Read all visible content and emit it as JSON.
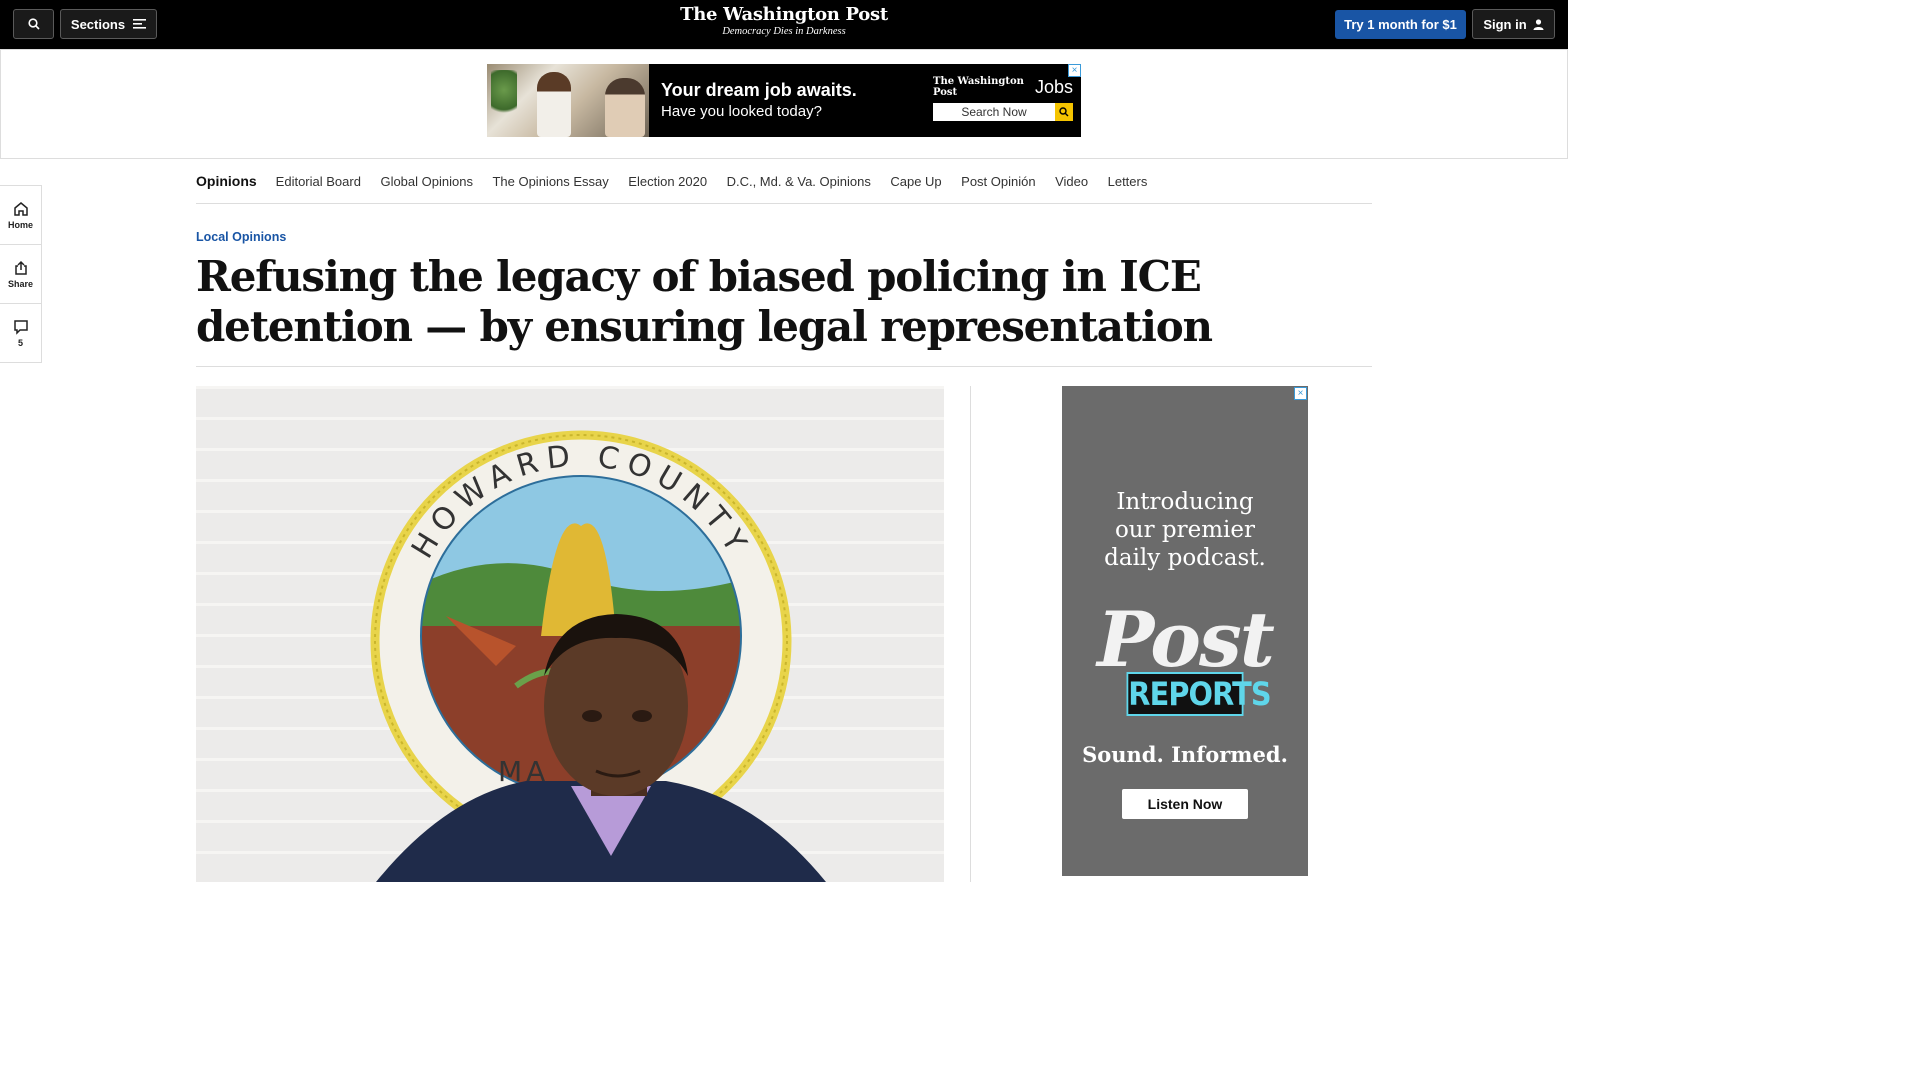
{
  "header": {
    "logo": "The Washington Post",
    "tagline": "Democracy Dies in Darkness",
    "sections_label": "Sections",
    "try_label": "Try 1 month for $1",
    "signin_label": "Sign in"
  },
  "top_ad": {
    "headline": "Your dream job awaits.",
    "subline": "Have you looked today?",
    "brand": "The Washington Post",
    "brand_suffix": "Jobs",
    "search_label": "Search Now",
    "close": "×"
  },
  "subnav": {
    "items": [
      "Opinions",
      "Editorial Board",
      "Global Opinions",
      "The Opinions Essay",
      "Election 2020",
      "D.C., Md. & Va. Opinions",
      "Cape Up",
      "Post Opinión",
      "Video",
      "Letters"
    ]
  },
  "rail": {
    "home": "Home",
    "share": "Share",
    "comments_count": "5"
  },
  "article": {
    "kicker": "Local Opinions",
    "headline": "Refusing the legacy of biased policing in ICE detention — by ensuring legal representation"
  },
  "hero_image": {
    "seal_top": "HOWARD COUNTY",
    "seal_bottom": "MA"
  },
  "side_ad": {
    "intro_line1": "Introducing",
    "intro_line2": "our premier",
    "intro_line3": "daily podcast.",
    "logo_main": "Post",
    "logo_sub": "REPORTS",
    "slogan": "Sound. Informed.",
    "cta": "Listen Now",
    "close": "×"
  },
  "colors": {
    "brand_blue": "#1955a5",
    "topbar": "#000000"
  }
}
